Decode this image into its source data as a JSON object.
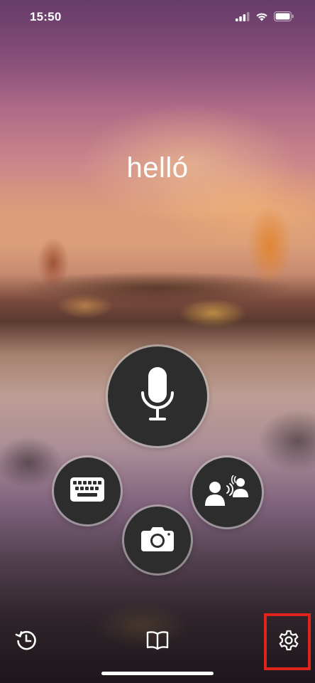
{
  "status_bar": {
    "time": "15:50",
    "signal_icon": "cellular-signal-icon",
    "wifi_icon": "wifi-icon",
    "battery_icon": "battery-icon"
  },
  "main": {
    "phrase": "helló"
  },
  "actions": [
    {
      "name": "microphone-button",
      "icon": "microphone-icon"
    },
    {
      "name": "keyboard-button",
      "icon": "keyboard-icon"
    },
    {
      "name": "conversation-button",
      "icon": "conversation-icon"
    },
    {
      "name": "camera-button",
      "icon": "camera-icon"
    }
  ],
  "toolbar": {
    "history_icon": "history-icon",
    "phrasebook_icon": "book-icon",
    "settings_icon": "gear-icon",
    "highlight_color": "#e0231b"
  },
  "theme": {
    "button_bg": "#2d2d2d",
    "icon_color": "#ffffff"
  }
}
